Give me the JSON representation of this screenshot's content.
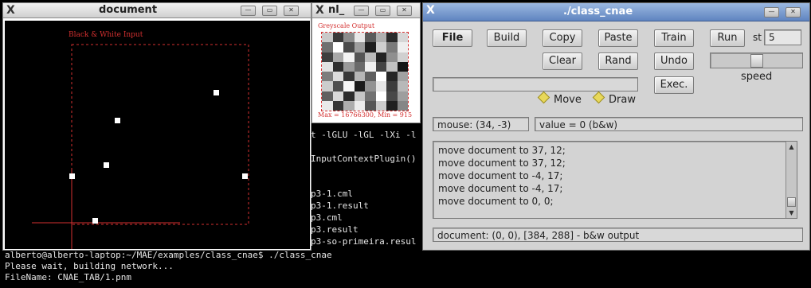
{
  "terminal": {
    "lines_right": [
      "t -lGLU -lGL -lXi -l",
      "InputContextPlugin()",
      "p3-1.cml",
      "p3-1.result",
      "p3.cml",
      "p3.result",
      "p3-so-primeira.resul"
    ],
    "lines_bottom": [
      "alberto@alberto-laptop:~/MAE/examples/class_cnae$ ./class_cnae",
      "Please wait, building network...",
      "FileName: CNAE_TAB/1.pnm"
    ]
  },
  "document_window": {
    "title": "document",
    "canvas_label": "Black & White Input"
  },
  "nl_window": {
    "title": "nl_",
    "top_label": "Greyscale Output",
    "bottom_label": "Max = 16766300, Min = 915",
    "grid_shades": [
      "#c9c9c9",
      "#3a3a3a",
      "#8c8c8c",
      "#e8e8e8",
      "#5a5a5a",
      "#b0b0b0",
      "#2a2a2a",
      "#d6d6d6",
      "#6f6f6f",
      "#ffffff",
      "#4b4b4b",
      "#9d9d9d",
      "#1e1e1e",
      "#cfcfcf",
      "#7a7a7a",
      "#eeeeee",
      "#3f3f3f",
      "#a8a8a8",
      "#f4f4f4",
      "#555555",
      "#bbbbbb",
      "#222222",
      "#8f8f8f",
      "#d0d0d0",
      "#e2e2e2",
      "#2f2f2f",
      "#9a9a9a",
      "#6a6a6a",
      "#f0f0f0",
      "#444444",
      "#c2c2c2",
      "#151515",
      "#7d7d7d",
      "#dcdcdc",
      "#383838",
      "#b6b6b6",
      "#5f5f5f",
      "#ffffff",
      "#262626",
      "#a2a2a2",
      "#cccccc",
      "#4e4e4e",
      "#f6f6f6",
      "#1a1a1a",
      "#929292",
      "#e5e5e5",
      "#3c3c3c",
      "#b8b8b8",
      "#606060",
      "#d9d9d9",
      "#2c2c2c",
      "#c5c5c5",
      "#717171",
      "#ffffff",
      "#484848",
      "#9e9e9e",
      "#e9e9e9",
      "#353535",
      "#adadad",
      "#ececec",
      "#575757",
      "#cdcdcd",
      "#212121",
      "#868686"
    ]
  },
  "cnae_window": {
    "title": "./class_cnae",
    "buttons": {
      "file": "File",
      "build": "Build",
      "copy": "Copy",
      "paste": "Paste",
      "train": "Train",
      "run": "Run",
      "clear": "Clear",
      "rand": "Rand",
      "undo": "Undo",
      "exec": "Exec."
    },
    "st_label": "st",
    "st_value": "5",
    "speed_label": "speed",
    "speed_level": 0.5,
    "command_value": "",
    "radio_move": "Move",
    "radio_draw": "Draw",
    "mouse_status": "mouse: (34, -3)",
    "value_status": "value = 0 (b&w)",
    "log_lines": [
      "move document to 37, 12;",
      "move document to 37, 12;",
      "move document to -4, 17;",
      "move document to -4, 17;",
      "move document to 0, 0;"
    ],
    "footer_status": "document: (0, 0), [384, 288]  -  b&w output"
  },
  "colors": {
    "selection_red": "#d43030",
    "cnae_title_blue": "#6f92cb",
    "window_grey": "#d3d3d3"
  }
}
